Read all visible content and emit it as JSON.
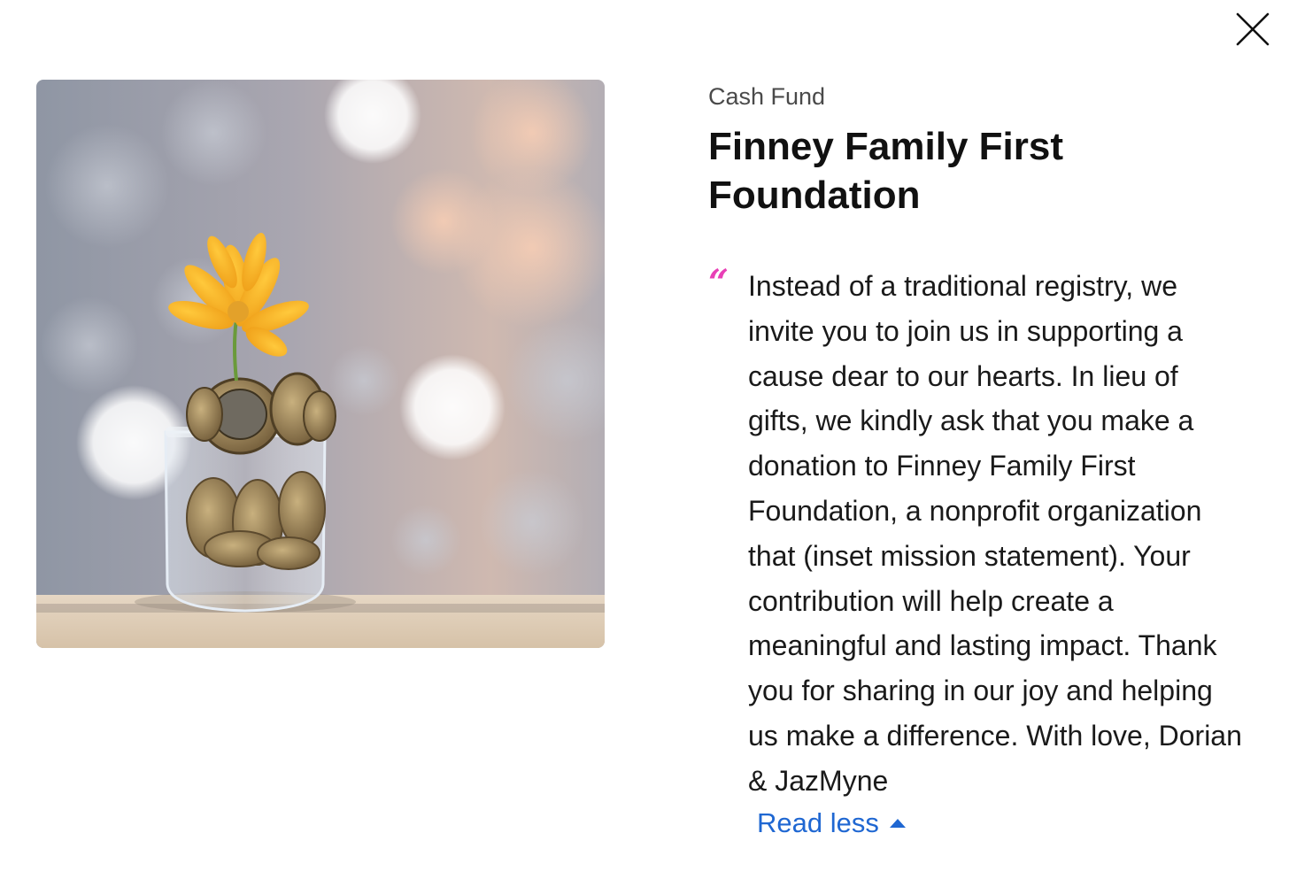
{
  "dialog": {
    "close_icon": "close-icon",
    "close_label": "Close"
  },
  "image": {
    "alt": "Glass jar filled with coins with a yellow flower growing out of it"
  },
  "fund": {
    "type": "Cash Fund",
    "title": "Finney Family First Foundation",
    "quote_mark": "“",
    "message": "Instead of a traditional registry, we invite you to join us in supporting a cause dear to our hearts. In lieu of gifts, we kindly ask that you make a donation to Finney Family First Foundation, a nonprofit organization that (inset mission statement). Your contribution will help create a meaningful and lasting impact. Thank you for sharing in our joy and helping us make a difference. With love, Dorian & JazMyne",
    "read_less_label": "Read less",
    "read_less_icon": "caret-up-icon"
  },
  "colors": {
    "accent_link": "#1f67d2",
    "quote_mark": "#e83fb6",
    "title": "#111111",
    "subtitle": "#4a4a4a"
  }
}
